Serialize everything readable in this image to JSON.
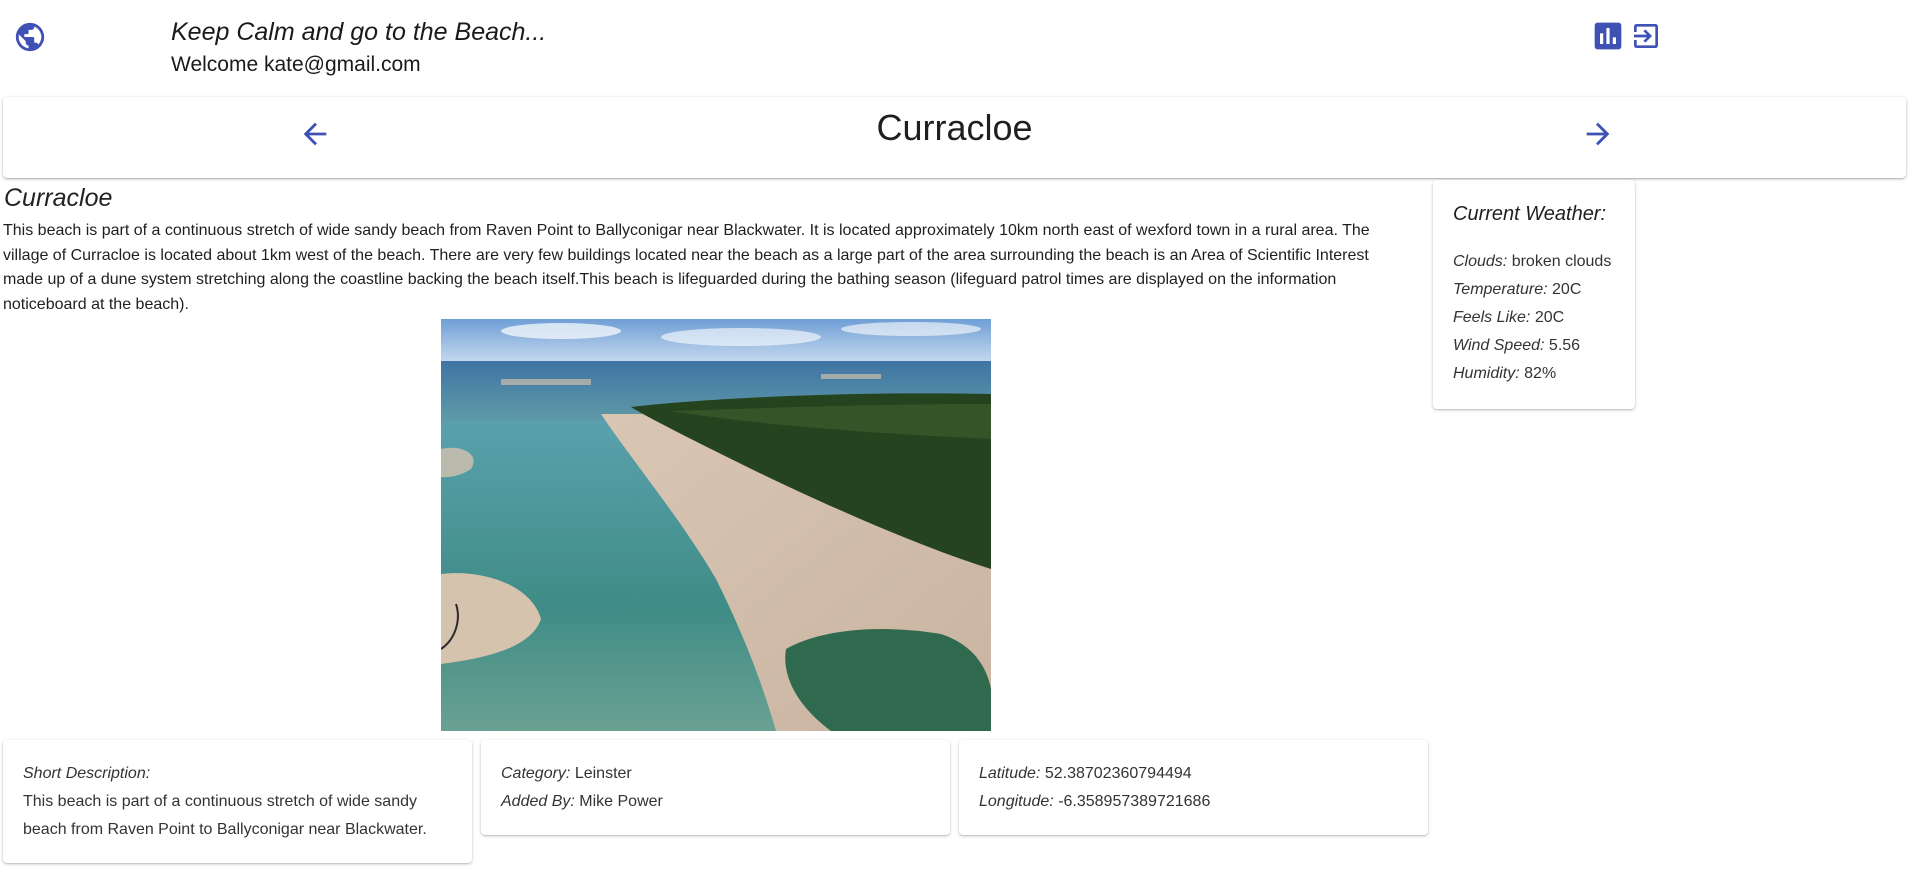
{
  "header": {
    "tagline": "Keep Calm and go to the Beach...",
    "welcome": "Welcome kate@gmail.com",
    "globe_icon": "globe-icon",
    "actions": [
      {
        "icon": "bar-chart-icon"
      },
      {
        "icon": "logout-icon"
      }
    ]
  },
  "nav": {
    "title": "Curracloe",
    "prev_icon": "arrow-left-icon",
    "next_icon": "arrow-right-icon"
  },
  "beach": {
    "name": "Curracloe",
    "description": "This beach is part of a continuous stretch of wide sandy beach from Raven Point to Ballyconigar near Blackwater. It is located approximately 10km north east of wexford town in a rural area. The village of Curracloe is located about 1km west of the beach. There are very few buildings located near the beach as a large part of the area surrounding the beach is an Area of Scientific Interest made up of a dune system stretching along the coastline backing the beach itself.This beach is lifeguarded during the bathing season (lifeguard patrol times are displayed on the information noticeboard at the beach)."
  },
  "weather": {
    "title": "Current Weather:",
    "rows": [
      {
        "label": "Clouds:",
        "value": "broken clouds"
      },
      {
        "label": "Temperature:",
        "value": "20C"
      },
      {
        "label": "Feels Like:",
        "value": "20C"
      },
      {
        "label": "Wind Speed:",
        "value": "5.56"
      },
      {
        "label": "Humidity:",
        "value": "82%"
      }
    ]
  },
  "details": {
    "short_label": "Short Description:",
    "short_value": "This beach is part of a continuous stretch of wide sandy beach from Raven Point to Ballyconigar near Blackwater.",
    "category_label": "Category:",
    "category_value": "Leinster",
    "added_by_label": "Added By:",
    "added_by_value": "Mike Power",
    "latitude_label": "Latitude:",
    "latitude_value": "52.38702360794494",
    "longitude_label": "Longitude:",
    "longitude_value": "-6.358957389721686"
  },
  "colors": {
    "accent": "#3f51b5",
    "text": "#222222",
    "card_bg": "#ffffff"
  }
}
